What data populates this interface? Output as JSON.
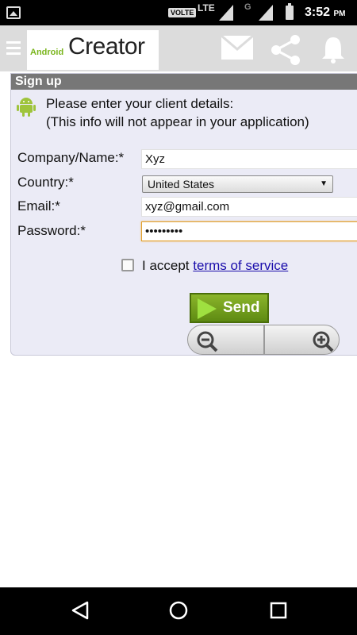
{
  "status_bar": {
    "volte": "VOLTE",
    "lte": "LTE",
    "g": "G",
    "time": "3:52",
    "ampm": "PM"
  },
  "app": {
    "logo_small": "Android",
    "logo_big": "Creator",
    "icons": [
      "menu-icon",
      "mail-icon",
      "share-icon",
      "bell-icon"
    ]
  },
  "form": {
    "title": "Sign up",
    "intro_line1": "Please enter your client details:",
    "intro_line2": "(This info will not appear in your application)",
    "company_label": "Company/Name:*",
    "company_value": "Xyz",
    "country_label": "Country:*",
    "country_value": "United States",
    "email_label": "Email:*",
    "email_value": "xyz@gmail.com",
    "password_label": "Password:*",
    "password_value": "•••••••••",
    "accept_text": "I accept",
    "terms_link": "terms of service",
    "accept_checked": false,
    "send_label": "Send"
  },
  "colors": {
    "panel_title_bg": "#777777",
    "panel_bg": "#ebebf6",
    "send_bg": "#6a9a1a",
    "link": "#1a0dab"
  }
}
